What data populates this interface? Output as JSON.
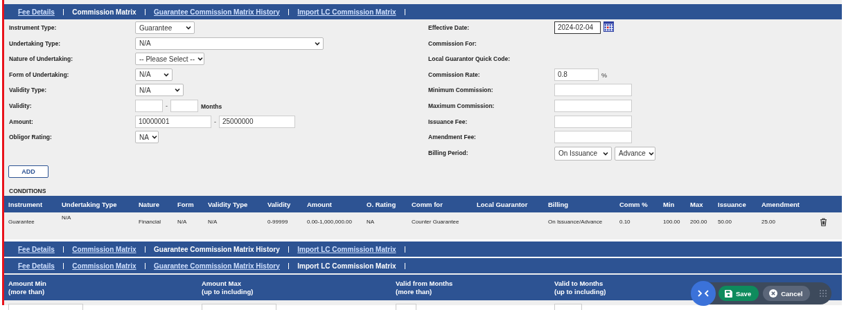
{
  "tabs_top": [
    {
      "label": "Fee Details",
      "selected": false
    },
    {
      "label": "Commission Matrix",
      "selected": true
    },
    {
      "label": "Guarantee Commission Matrix History",
      "selected": false
    },
    {
      "label": "Import LC Commission Matrix",
      "selected": false
    }
  ],
  "left_fields": [
    {
      "label": "Instrument Type:",
      "kind": "select",
      "value": "Guarantee"
    },
    {
      "label": "Undertaking Type:",
      "kind": "select",
      "value": "N/A"
    },
    {
      "label": "Nature of Undertaking:",
      "kind": "select",
      "value": "-- Please Select --"
    },
    {
      "label": "Form of Undertaking:",
      "kind": "select",
      "value": "N/A"
    },
    {
      "label": "Validity Type:",
      "kind": "select",
      "value": "N/A"
    },
    {
      "label": "Validity:",
      "kind": "range",
      "separator": "-",
      "unit": "Months"
    },
    {
      "label": "Amount:",
      "kind": "range",
      "from": "10000001",
      "separator": "-",
      "to": "25000000"
    },
    {
      "label": "Obligor Rating:",
      "kind": "select",
      "value": "NA"
    }
  ],
  "right_fields": [
    {
      "label": "Effective Date:",
      "kind": "date",
      "value": "2024-02-04"
    },
    {
      "label": "Commission For:",
      "kind": "text"
    },
    {
      "label": "Local Guarantor Quick Code:",
      "kind": "text"
    },
    {
      "label": "Commission Rate:",
      "kind": "input",
      "value": "0.8",
      "unit": "%"
    },
    {
      "label": "Minimum Commission:",
      "kind": "input"
    },
    {
      "label": "Maximum Commission:",
      "kind": "input"
    },
    {
      "label": "Issuance Fee:",
      "kind": "input"
    },
    {
      "label": "Amendment Fee:",
      "kind": "input"
    },
    {
      "label": "Billing Period:",
      "kind": "selects",
      "values": [
        "On Issuance",
        "Advance"
      ]
    }
  ],
  "add_button": "ADD",
  "conditions": {
    "title": "CONDITIONS",
    "columns": [
      "Instrument",
      "Undertaking Type",
      "Nature",
      "Form",
      "Validity Type",
      "Validity",
      "Amount",
      "O. Rating",
      "Comm for",
      "Local Guarantor",
      "Billing",
      "Comm %",
      "Min",
      "Max",
      "Issuance",
      "Amendment"
    ],
    "rows": [
      [
        "Guarantee",
        "N/A",
        "Financial",
        "N/A",
        "N/A",
        "0-99999",
        "0.00-1,000,000.00",
        "NA",
        "Counter Guarantee",
        "",
        "On Issuance/Advance",
        "0.10",
        "100.00",
        "200.00",
        "50.00",
        "25.00"
      ]
    ]
  },
  "tabs_history": [
    {
      "label": "Fee Details",
      "selected": false
    },
    {
      "label": "Commission Matrix",
      "selected": false
    },
    {
      "label": "Guarantee Commission Matrix History",
      "selected": true
    },
    {
      "label": "Import LC Commission Matrix",
      "selected": false
    }
  ],
  "tabs_import": [
    {
      "label": "Fee Details",
      "selected": false
    },
    {
      "label": "Commission Matrix",
      "selected": false
    },
    {
      "label": "Guarantee Commission Matrix History",
      "selected": false
    },
    {
      "label": "Import LC Commission Matrix",
      "selected": true
    }
  ],
  "import_lc": {
    "columns": [
      [
        "Amount Min",
        "(more than)"
      ],
      [
        "Amount Max",
        "(up to including)"
      ],
      [
        "Valid from Months",
        "(more than)"
      ],
      [
        "Valid to Months",
        "(up to including)"
      ]
    ]
  },
  "toolbar": {
    "save": "Save",
    "cancel": "Cancel"
  }
}
